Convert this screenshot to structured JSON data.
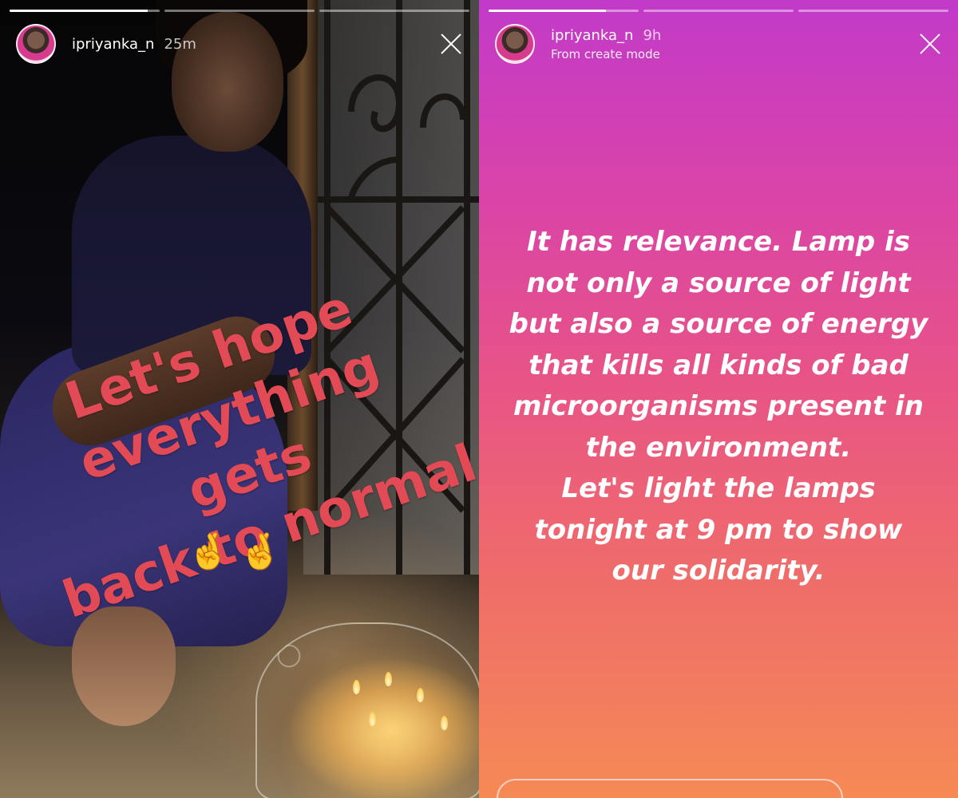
{
  "stories": [
    {
      "progress": [
        0.92,
        0,
        0
      ],
      "username": "ipriyanka_n",
      "time_ago": "25m",
      "caption_lines": [
        "Let's hope",
        "everything gets",
        "back to normal"
      ],
      "emoji": "🤞🤞",
      "caption_color": "#e24a55"
    },
    {
      "progress": [
        0.78,
        0,
        0
      ],
      "username": "ipriyanka_n",
      "time_ago": "9h",
      "subtitle": "From create mode",
      "text_lines": [
        "It has relevance. Lamp is",
        "not only a source of light",
        "but also a source of energy",
        "that kills all kinds of bad",
        "microorganisms present in",
        "the environment.",
        "Let's light the lamps",
        "tonight at 9 pm to show",
        "our solidarity."
      ],
      "gradient": [
        "#c13ac9",
        "#f58a55"
      ]
    }
  ],
  "icons": [
    "close-icon",
    "avatar"
  ]
}
